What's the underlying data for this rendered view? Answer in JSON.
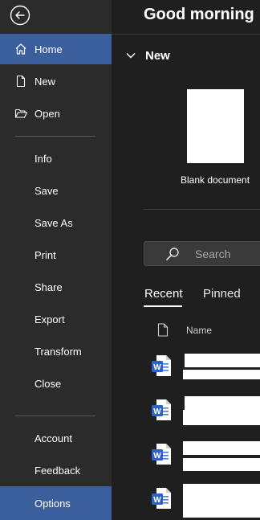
{
  "header": {
    "greeting": "Good morning"
  },
  "sidebar": {
    "items": [
      {
        "label": "Home",
        "icon": "home-icon"
      },
      {
        "label": "New",
        "icon": "new-doc-icon"
      },
      {
        "label": "Open",
        "icon": "folder-open-icon"
      },
      {
        "label": "Info"
      },
      {
        "label": "Save"
      },
      {
        "label": "Save As"
      },
      {
        "label": "Print"
      },
      {
        "label": "Share"
      },
      {
        "label": "Export"
      },
      {
        "label": "Transform"
      },
      {
        "label": "Close"
      },
      {
        "label": "Account"
      },
      {
        "label": "Feedback"
      },
      {
        "label": "Options"
      }
    ],
    "selected": "Home",
    "accent": "#3a5f9c"
  },
  "new_section": {
    "title": "New",
    "blank_document_label": "Blank document"
  },
  "search": {
    "placeholder": "Search"
  },
  "tabs": [
    {
      "label": "Recent",
      "active": true
    },
    {
      "label": "Pinned",
      "active": false
    }
  ],
  "file_list": {
    "column_name": "Name",
    "rows": [
      {
        "icon": "word-doc-icon"
      },
      {
        "icon": "word-doc-icon"
      },
      {
        "icon": "word-doc-icon"
      },
      {
        "icon": "word-doc-icon"
      }
    ]
  }
}
